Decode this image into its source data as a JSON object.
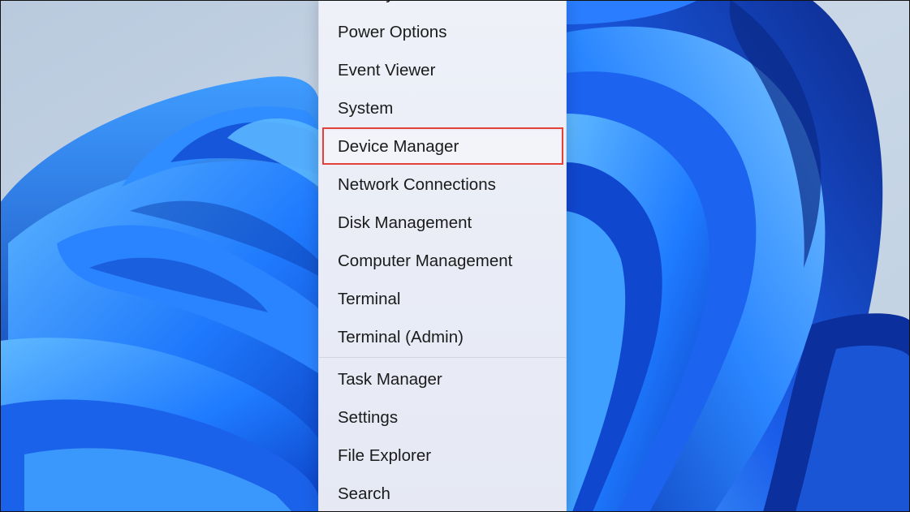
{
  "context_menu": {
    "items_top": [
      "Mobility Center",
      "Power Options",
      "Event Viewer",
      "System",
      "Device Manager",
      "Network Connections",
      "Disk Management",
      "Computer Management",
      "Terminal",
      "Terminal (Admin)"
    ],
    "items_bottom": [
      "Task Manager",
      "Settings",
      "File Explorer",
      "Search"
    ],
    "highlighted_item": "Device Manager"
  },
  "colors": {
    "highlight_border": "#e5413b",
    "wallpaper_blue": "#1f6fff",
    "menu_background": "#eef1f8"
  }
}
